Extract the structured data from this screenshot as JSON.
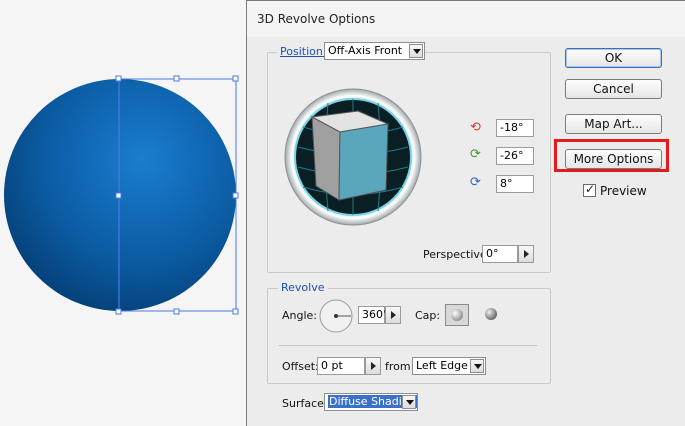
{
  "dialog": {
    "title": "3D Revolve Options",
    "position_label": "Position:",
    "position_value": "Off-Axis Front",
    "x_rotation": "-18°",
    "y_rotation": "-26°",
    "z_rotation": "8°",
    "perspective_label": "Perspective:",
    "perspective_value": "0°",
    "revolve_legend": "Revolve",
    "angle_label": "Angle:",
    "angle_value": "360°",
    "cap_label": "Cap:",
    "offset_label": "Offset:",
    "offset_value": "0 pt",
    "from_label": "from",
    "from_value": "Left Edge",
    "surface_label": "Surface:",
    "surface_value": "Diffuse Shading"
  },
  "buttons": {
    "ok": "OK",
    "cancel": "Cancel",
    "map_art": "Map Art...",
    "more_options": "More Options",
    "preview": "Preview"
  },
  "colors": {
    "highlight": "#e41b1b",
    "sphere": "#0b5fa5",
    "cube_face": "#5aa7bd"
  }
}
